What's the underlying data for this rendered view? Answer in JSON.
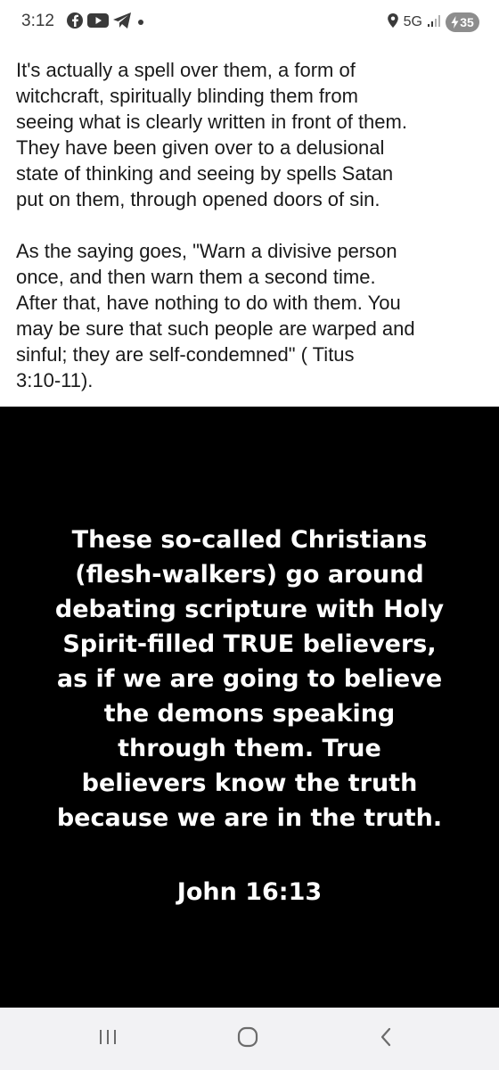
{
  "status_bar": {
    "time": "3:12",
    "left_icons": [
      "facebook-messenger-icon",
      "youtube-icon",
      "telegram-icon",
      "dot-icon"
    ],
    "network": "5G",
    "battery": "35",
    "right_icons": [
      "location-icon",
      "signal-icon",
      "battery-charging-icon"
    ]
  },
  "post": {
    "paragraph_1": "It's actually a spell over them, a form of\nwitchcraft, spiritually blinding them from\nseeing what is clearly written in front of them.\nThey have been given over to a delusional\nstate of thinking and seeing by spells Satan\nput on them, through opened doors of sin.",
    "paragraph_2": "As the saying goes, \"Warn a divisive person\nonce, and then warn them a second time.\nAfter that, have nothing to do with them.  You\nmay be sure that such people are warped and\nsinful; they are self-condemned\" ( Titus\n3:10-11)."
  },
  "quote_image": {
    "background": "#000000",
    "text": "These so-called Christians\n(flesh-walkers) go around\ndebating scripture with Holy\nSpirit-filled TRUE believers,\nas if we are going to believe\nthe demons speaking\nthrough them. True\nbelievers know the truth\nbecause we are in the truth.",
    "reference": "John 16:13"
  },
  "nav_bar": {
    "buttons": [
      "recent-apps-icon",
      "home-icon",
      "back-icon"
    ]
  }
}
